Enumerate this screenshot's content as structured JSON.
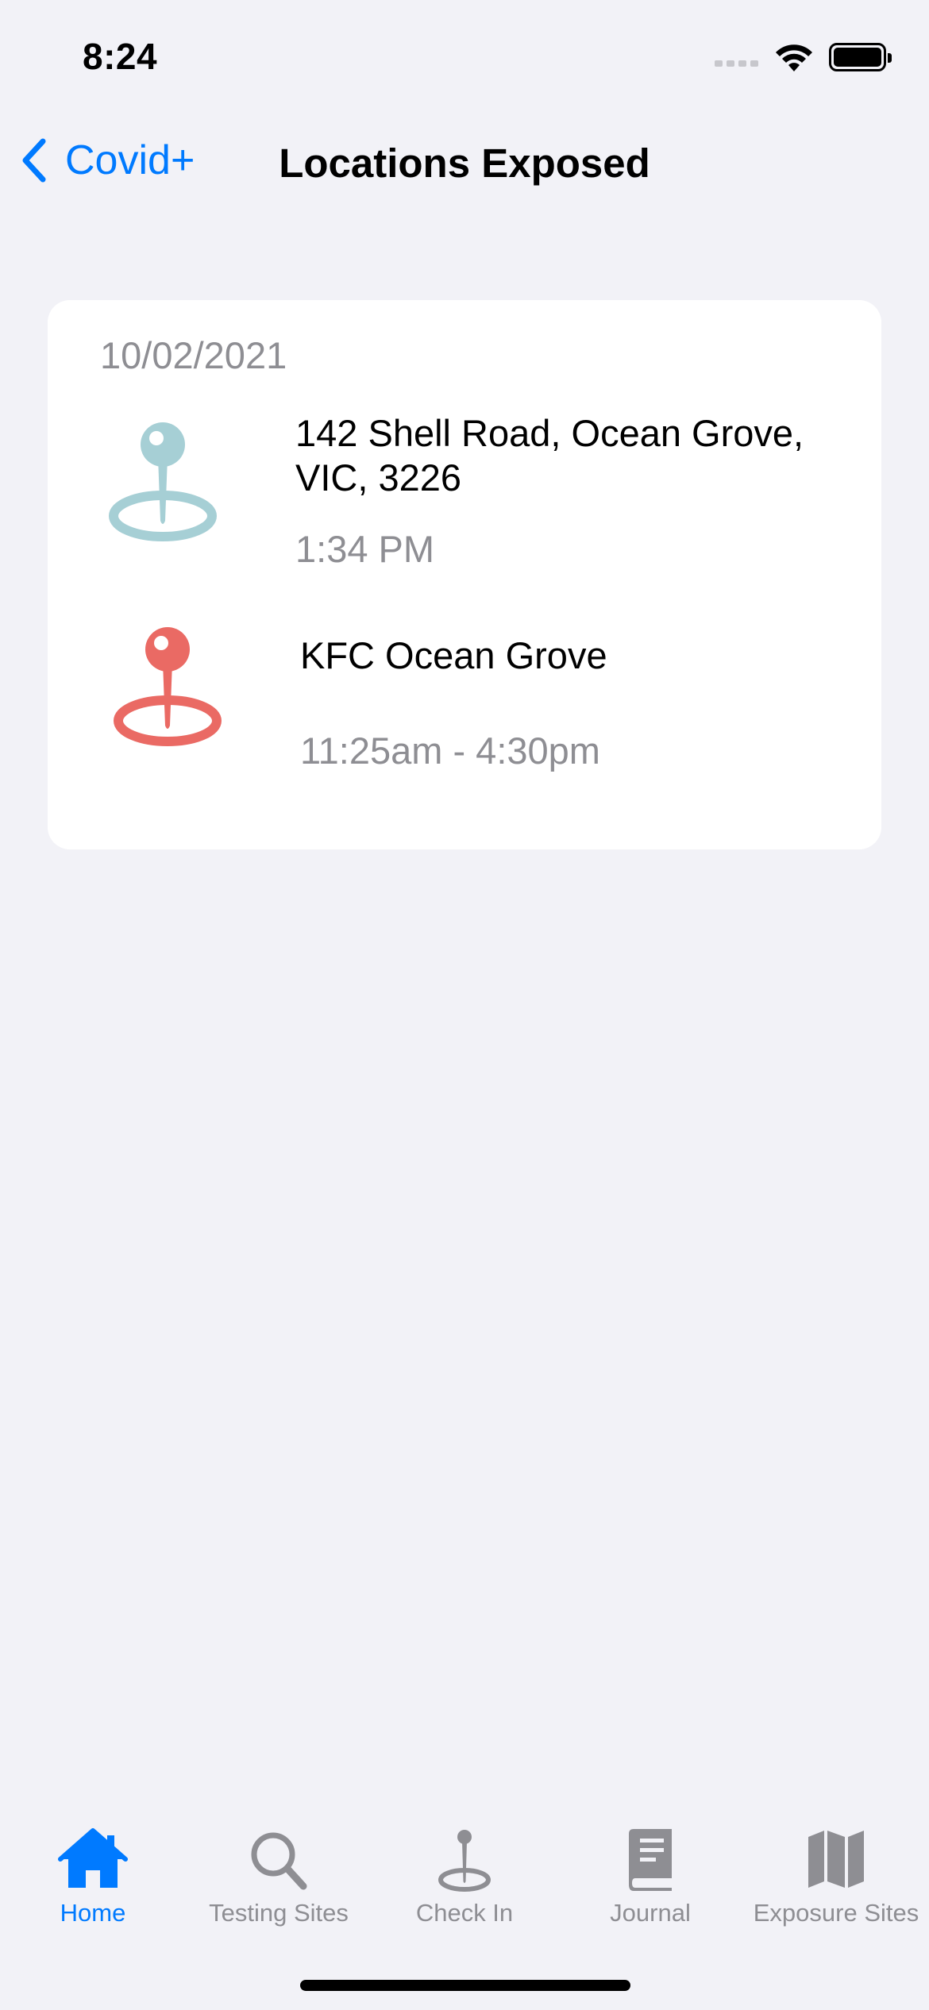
{
  "status_bar": {
    "time": "8:24",
    "icons": [
      "signal-icon",
      "wifi-icon",
      "battery-icon"
    ]
  },
  "nav": {
    "back_label": "Covid+",
    "title": "Locations Exposed"
  },
  "exposures": {
    "date": "10/02/2021",
    "locations": [
      {
        "name": "142 Shell Road, Ocean Grove, VIC, 3226",
        "time": "1:34 PM",
        "icon": "location-pin-icon",
        "color": "#a6cfd5"
      },
      {
        "name": "KFC Ocean Grove",
        "time": "11:25am - 4:30pm",
        "icon": "location-pin-icon",
        "color": "#ea6a64"
      }
    ]
  },
  "tab_bar": {
    "active": "Home",
    "tabs": [
      {
        "label": "Home",
        "icon": "house-icon"
      },
      {
        "label": "Testing Sites",
        "icon": "magnifying-glass-icon"
      },
      {
        "label": "Check In",
        "icon": "location-pin-icon"
      },
      {
        "label": "Journal",
        "icon": "book-icon"
      },
      {
        "label": "Exposure Sites",
        "icon": "map-icon"
      }
    ]
  },
  "colors": {
    "accent": "#007aff",
    "secondary_text": "#8e8e93",
    "background": "#f2f2f7",
    "card": "#ffffff"
  }
}
